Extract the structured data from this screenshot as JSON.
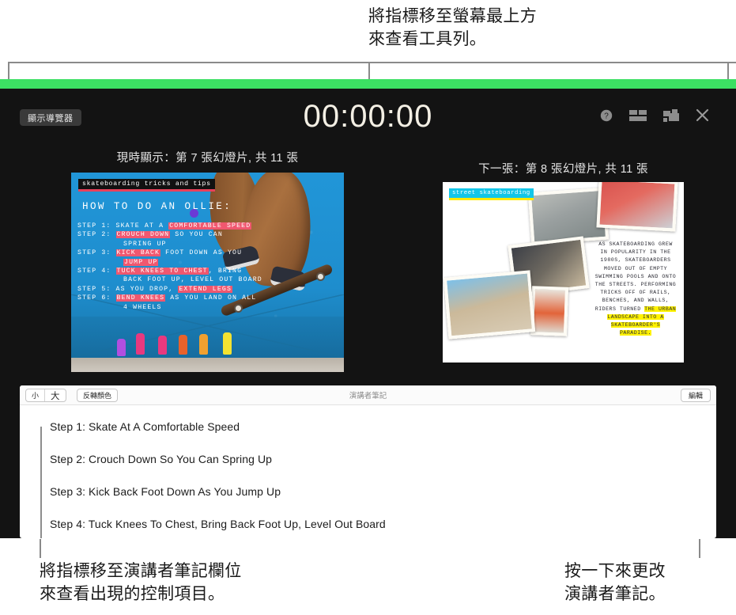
{
  "callouts": {
    "top": "將指標移至螢幕最上方\n來查看工具列。",
    "bottom_left": "將指標移至演講者筆記欄位\n來查看出現的控制項目。",
    "bottom_right": "按一下來更改\n演講者筆記。"
  },
  "toolbar": {
    "navigator_label": "顯示導覽器",
    "timer": "00:00:00",
    "icons": [
      {
        "name": "help-icon",
        "glyph": "?"
      },
      {
        "name": "layout-icon",
        "glyph": "▤"
      },
      {
        "name": "presenter-display-icon",
        "glyph": "▣"
      },
      {
        "name": "close-icon",
        "glyph": "✕"
      }
    ]
  },
  "slides": {
    "current_label": "現時顯示：第 7 張幻燈片, 共 11 張",
    "next_label": "下一張：第 8 張幻燈片, 共 11 張",
    "current": {
      "badge": "skateboarding tricks and tips",
      "heading": "HOW TO DO AN OLLIE:",
      "steps": [
        {
          "label": "STEP 1:",
          "plain_before": "SKATE AT A ",
          "highlight": "COMFORTABLE SPEED",
          "plain_after": ""
        },
        {
          "label": "STEP 2:",
          "plain_before": "",
          "highlight": "CROUCH DOWN",
          "plain_after": " SO YOU CAN"
        },
        {
          "label": "",
          "plain_before": "SPRING UP",
          "highlight": "",
          "plain_after": ""
        },
        {
          "label": "STEP 3:",
          "plain_before": "",
          "highlight": "KICK BACK",
          "plain_after": " FOOT DOWN AS YOU"
        },
        {
          "label": "",
          "plain_before": "",
          "highlight": "JUMP UP",
          "plain_after": ""
        },
        {
          "label": "STEP 4:",
          "plain_before": "",
          "highlight": "TUCK KNEES TO CHEST",
          "plain_after": ", BRING"
        },
        {
          "label": "",
          "plain_before": "BACK FOOT UP, LEVEL OUT BOARD",
          "highlight": "",
          "plain_after": ""
        },
        {
          "label": "STEP 5:",
          "plain_before": "AS YOU DROP, ",
          "highlight": "EXTEND LEGS",
          "plain_after": ""
        },
        {
          "label": "STEP 6:",
          "plain_before": "",
          "highlight": "BEND KNEES",
          "plain_after": " AS YOU LAND ON ALL"
        },
        {
          "label": "",
          "plain_before": "4 WHEELS",
          "highlight": "",
          "plain_after": ""
        }
      ]
    },
    "next": {
      "badge": "street skateboarding",
      "body_plain": "AS SKATEBOARDING GREW IN POPULARITY IN THE 1980S, SKATEBOARDERS MOVED OUT OF EMPTY SWIMMING POOLS AND ONTO THE STREETS. PERFORMING TRICKS OFF OF RAILS, BENCHES, AND WALLS, RIDERS TURNED ",
      "body_highlight": "THE URBAN LANDSCAPE INTO A SKATEBOARDER'S PARADISE."
    }
  },
  "notes": {
    "size_small_label": "小",
    "size_large_label": "大",
    "invert_label": "反轉顏色",
    "caption": "演講者筆記",
    "edit_label": "編輯",
    "lines": [
      "Step 1: Skate At A Comfortable Speed",
      "Step 2: Crouch Down So You Can Spring Up",
      "Step 3: Kick Back Foot Down As You Jump Up",
      "Step 4: Tuck Knees To Chest, Bring Back Foot Up, Level Out Board"
    ]
  },
  "colors": {
    "green_bar": "#3ce063",
    "window_bg": "#131313",
    "timer_text": "#f3efe4",
    "highlight_red": "#f0576f",
    "highlight_yellow": "#fff200"
  }
}
